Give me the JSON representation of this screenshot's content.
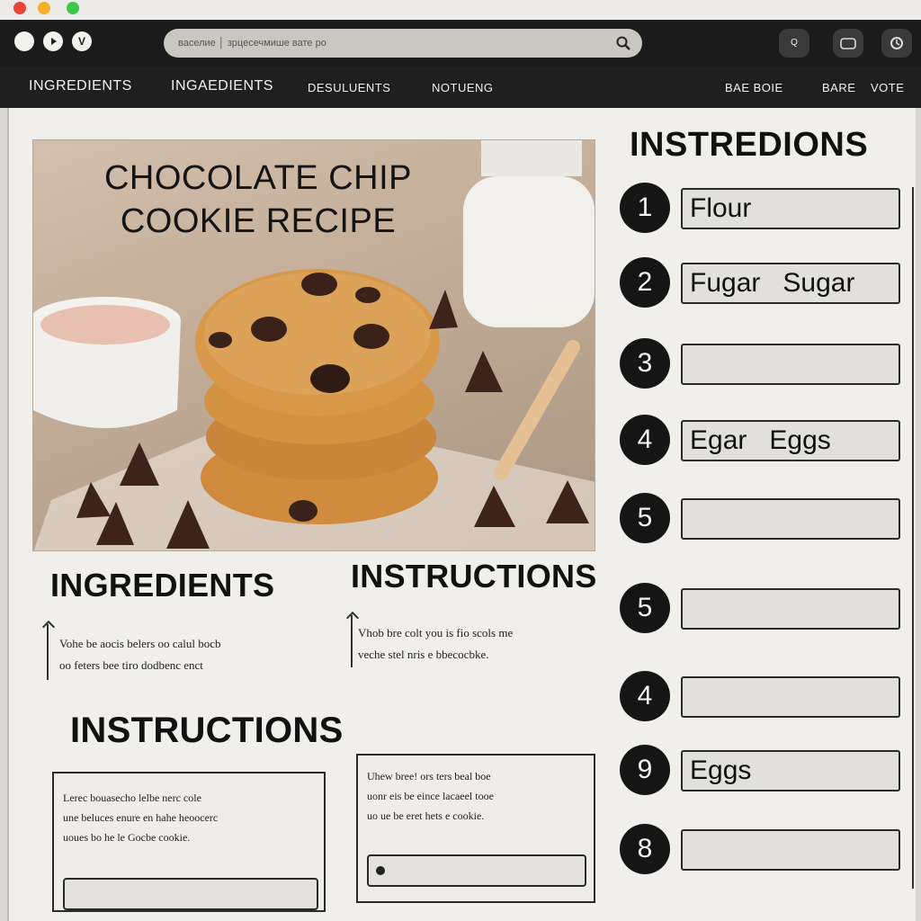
{
  "browser": {
    "address": "васелие │ зрцесечмише вате ро",
    "window_buttons": [
      "",
      "",
      "V"
    ],
    "tools": [
      "Q",
      "",
      ""
    ]
  },
  "nav": {
    "items": [
      "INGREDIENTS",
      "INGAEDIENTS",
      "DESULUENTS",
      "NOTUENG"
    ],
    "right_items": [
      "BAE BOIE",
      "BARE",
      "VOTE"
    ]
  },
  "hero": {
    "title_line1": "CHOCOLATE CHIP",
    "title_line2": "COOKIE RECIPE"
  },
  "main": {
    "ingredients_heading": "INGREDIENTS",
    "ingredients_text_1": "Vohe be aocis belers oo calul bocb",
    "ingredients_text_2": "oo feters bee tiro dodbenc enct",
    "instructions_heading_1": "INSTRUCTIONS",
    "instructions_text_1": "Vhob bre colt you is fio scols me",
    "instructions_text_2": "veche stel nris e bbecocbke.",
    "instructions_heading_2": "INSTRUCTIONS",
    "box1_text_1": "Lerec bouasecho lelbe nerc cole",
    "box1_text_2": "une beluces enure en hahe heoocerc",
    "box1_text_3": "uoues bo he le Gocbe cookie.",
    "box2_text_1": "Uhew bree! ors ters beal boe",
    "box2_text_2": "uonr eis be eince lacaeel tooe",
    "box2_text_3": "uo ue be eret hets e cookie."
  },
  "sidebar": {
    "heading": "INSTREDIONS",
    "steps": [
      {
        "num": "1",
        "value": "Flour"
      },
      {
        "num": "2",
        "value": "Fugar   Sugar"
      },
      {
        "num": "3",
        "value": ""
      },
      {
        "num": "4",
        "value": "Egar   Eggs"
      },
      {
        "num": "5",
        "value": ""
      },
      {
        "num": "5",
        "value": ""
      },
      {
        "num": "4",
        "value": ""
      },
      {
        "num": "9",
        "value": "Eggs"
      },
      {
        "num": "8",
        "value": ""
      }
    ]
  },
  "colors": {
    "chrome_dark": "#1b1b1b",
    "page_bg": "#f1efeb",
    "step_badge": "#151515"
  }
}
